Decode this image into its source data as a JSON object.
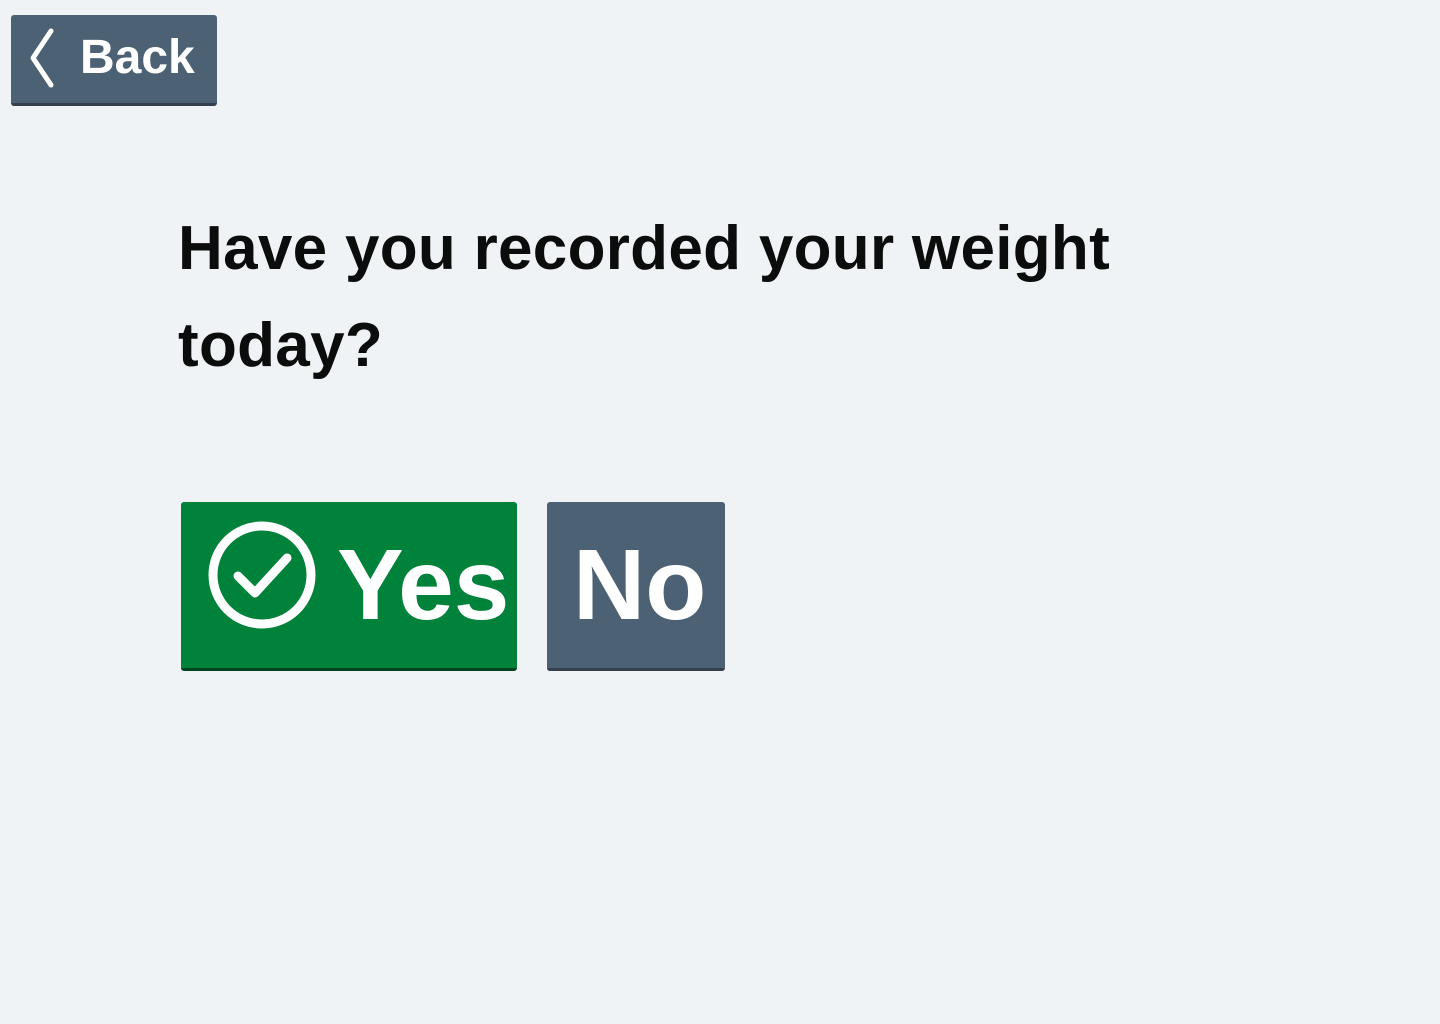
{
  "navigation": {
    "back_label": "Back",
    "back_icon": "chevron-left-icon"
  },
  "question": {
    "text": "Have you recorded your weight today?"
  },
  "answers": {
    "yes_label": "Yes",
    "yes_icon": "check-circle-icon",
    "no_label": "No"
  },
  "colors": {
    "background": "#eff3f5",
    "primary_button": "#00823b",
    "secondary_button": "#4d6174",
    "text": "#0b0c0c",
    "button_text": "#ffffff"
  }
}
